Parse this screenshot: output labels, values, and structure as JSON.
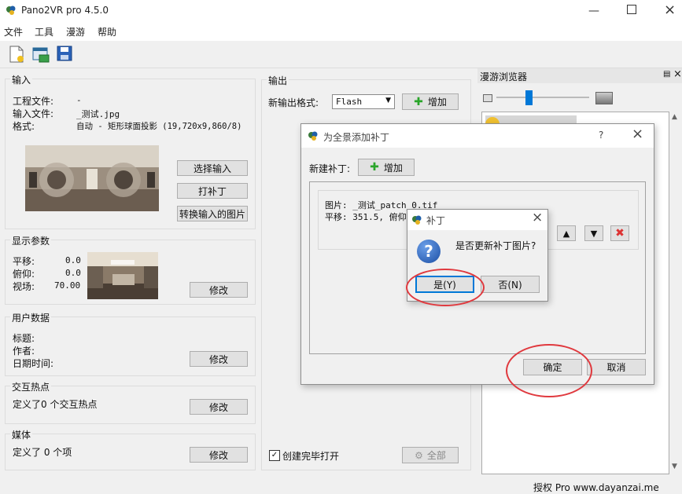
{
  "app": {
    "title": "Pano2VR pro 4.5.0"
  },
  "menu": [
    "文件",
    "工具",
    "漫游",
    "帮助"
  ],
  "input": {
    "section_label": "输入",
    "project_file_label": "工程文件:",
    "project_file_value": "-",
    "input_file_label": "输入文件:",
    "input_file_value": "_测试.jpg",
    "format_label": "格式:",
    "format_value": "自动 - 矩形球面投影 (19,720x9,860/8)",
    "select_input_button": "选择输入",
    "patch_button": "打补丁",
    "convert_input_button": "转换输入的图片"
  },
  "display": {
    "section_label": "显示参数",
    "pan_label": "平移:",
    "pan_value": "0.0",
    "tilt_label": "俯仰:",
    "tilt_value": "0.0",
    "fov_label": "视场:",
    "fov_value": "70.00",
    "modify_button": "修改"
  },
  "userdata": {
    "section_label": "用户数据",
    "title_label": "标题:",
    "author_label": "作者:",
    "datetime_label": "日期时间:",
    "modify_button": "修改"
  },
  "hotspots": {
    "section_label": "交互热点",
    "summary": "定义了0 个交互热点",
    "modify_button": "修改"
  },
  "media": {
    "section_label": "媒体",
    "summary": "定义了 0 个项",
    "modify_button": "修改"
  },
  "output": {
    "section_label": "输出",
    "new_format_label": "新输出格式:",
    "format_selected": "Flash",
    "add_button": "增加",
    "open_after_label": "创建完毕打开",
    "open_after_checked": true,
    "all_button": "全部"
  },
  "browser": {
    "title": "漫游浏览器"
  },
  "patch_dialog": {
    "title": "为全景添加补丁",
    "help": "?",
    "new_patch_label": "新建补丁:",
    "add_button": "增加",
    "image_line": "图片: _测试_patch_0.tif",
    "pan_line": "平移: 351.5, 俯仰",
    "ok_button": "确定",
    "cancel_button": "取消"
  },
  "confirm_dialog": {
    "title": "补丁",
    "message": "是否更新补丁图片?",
    "yes_button": "是(Y)",
    "no_button": "否(N)"
  },
  "status": {
    "text": "授权 Pro  www.dayanzai.me"
  },
  "colors": {
    "highlight_circle": "#e0393e",
    "accent_blue": "#0078d7"
  }
}
